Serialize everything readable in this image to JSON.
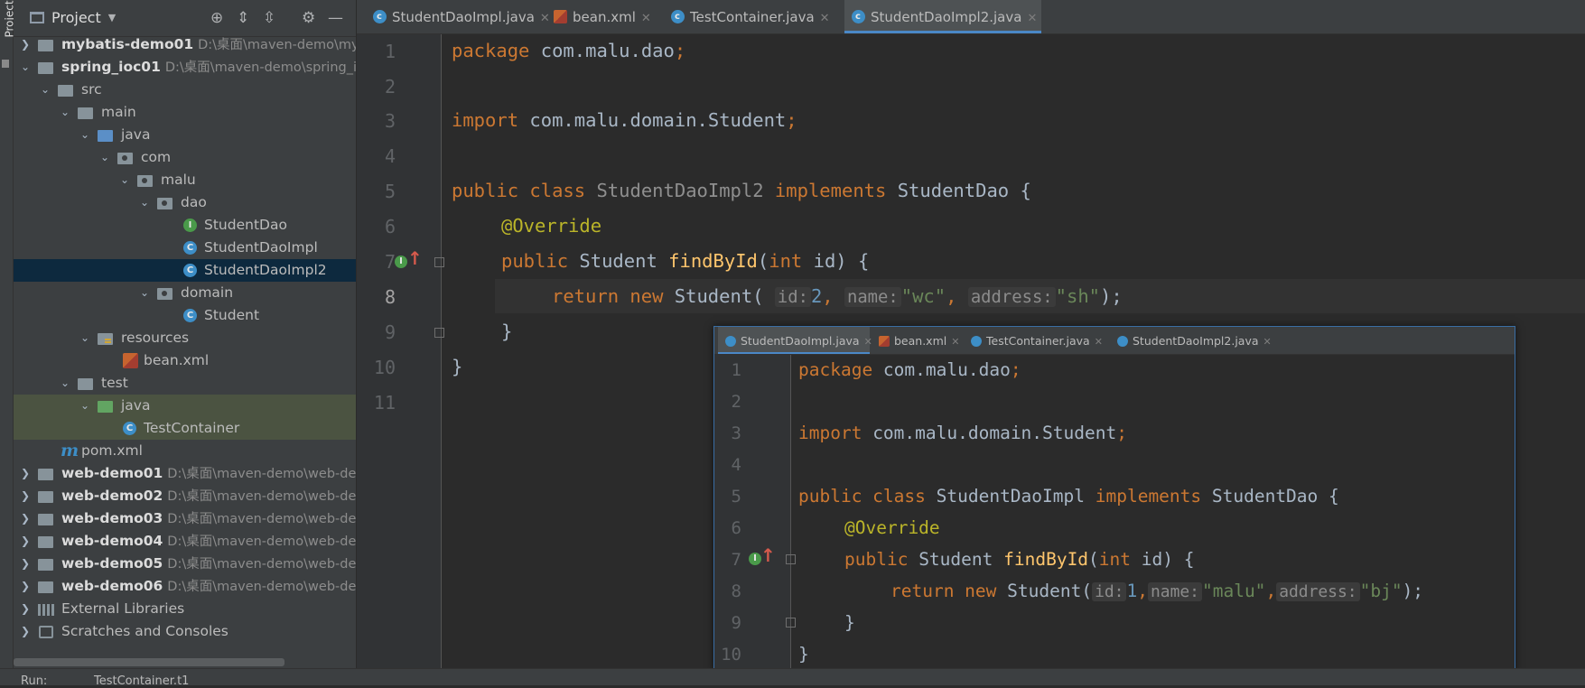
{
  "sidebar_stripe": {
    "label": "Project"
  },
  "project_panel": {
    "title": "Project",
    "tree": [
      {
        "label": "mybatis-demo01",
        "path": "D:\\桌面\\maven-demo\\myb",
        "icon": "module-folder-icon",
        "expanded": false
      },
      {
        "label": "spring_ioc01",
        "path": "D:\\桌面\\maven-demo\\spring_ic",
        "icon": "module-folder-icon",
        "expanded": true
      },
      {
        "label": "src",
        "icon": "folder-icon",
        "expanded": true
      },
      {
        "label": "main",
        "icon": "folder-icon",
        "expanded": true
      },
      {
        "label": "java",
        "icon": "source-folder-icon",
        "expanded": true
      },
      {
        "label": "com",
        "icon": "package-icon",
        "expanded": true
      },
      {
        "label": "malu",
        "icon": "package-icon",
        "expanded": true
      },
      {
        "label": "dao",
        "icon": "package-icon",
        "expanded": true
      },
      {
        "label": "StudentDao",
        "icon": "interface-icon"
      },
      {
        "label": "StudentDaoImpl",
        "icon": "class-icon"
      },
      {
        "label": "StudentDaoImpl2",
        "icon": "class-icon",
        "selected": true
      },
      {
        "label": "domain",
        "icon": "package-icon",
        "expanded": true
      },
      {
        "label": "Student",
        "icon": "class-icon"
      },
      {
        "label": "resources",
        "icon": "resources-folder-icon",
        "expanded": true
      },
      {
        "label": "bean.xml",
        "icon": "xml-file-icon"
      },
      {
        "label": "test",
        "icon": "folder-icon",
        "expanded": true
      },
      {
        "label": "java",
        "icon": "test-folder-icon",
        "expanded": true
      },
      {
        "label": "TestContainer",
        "icon": "test-class-icon"
      },
      {
        "label": "pom.xml",
        "icon": "maven-icon"
      },
      {
        "label": "web-demo01",
        "path": "D:\\桌面\\maven-demo\\web-de",
        "icon": "module-folder-icon",
        "expanded": false
      },
      {
        "label": "web-demo02",
        "path": "D:\\桌面\\maven-demo\\web-de",
        "icon": "module-folder-icon",
        "expanded": false
      },
      {
        "label": "web-demo03",
        "path": "D:\\桌面\\maven-demo\\web-de",
        "icon": "module-folder-icon",
        "expanded": false
      },
      {
        "label": "web-demo04",
        "path": "D:\\桌面\\maven-demo\\web-de",
        "icon": "module-folder-icon",
        "expanded": false
      },
      {
        "label": "web-demo05",
        "path": "D:\\桌面\\maven-demo\\web-de",
        "icon": "module-folder-icon",
        "expanded": false
      },
      {
        "label": "web-demo06",
        "path": "D:\\桌面\\maven-demo\\web-de",
        "icon": "module-folder-icon",
        "expanded": false
      },
      {
        "label": "External Libraries",
        "icon": "libraries-icon",
        "expanded": false
      },
      {
        "label": "Scratches and Consoles",
        "icon": "scratches-icon",
        "expanded": false
      }
    ]
  },
  "editor": {
    "tabs": [
      {
        "label": "StudentDaoImpl.java",
        "icon": "class-icon"
      },
      {
        "label": "bean.xml",
        "icon": "xml-file-icon"
      },
      {
        "label": "TestContainer.java",
        "icon": "test-class-icon"
      },
      {
        "label": "StudentDaoImpl2.java",
        "icon": "class-icon",
        "active": true
      }
    ],
    "line_numbers": [
      "1",
      "2",
      "3",
      "4",
      "5",
      "6",
      "7",
      "8",
      "9",
      "10",
      "11"
    ],
    "current_line": "8",
    "code": {
      "l1_kw": "package",
      "l1_rest": " com.malu.dao",
      "l1_semi": ";",
      "l3_kw": "import",
      "l3_rest": " com.malu.domain.Student",
      "l3_semi": ";",
      "l5_kw1": "public class",
      "l5_name": " StudentDaoImpl2",
      "l5_kw2": " implements",
      "l5_rest": " StudentDao {",
      "l6_ann": "@Override",
      "l7_kw": "public",
      "l7_type": " Student ",
      "l7_fn": "findById",
      "l7_p1": "(",
      "l7_kw2": "int",
      "l7_p2": " id) {",
      "l8_kw": "return new",
      "l8_type": " Student(",
      "l8_h1": "id:",
      "l8_v1": "2",
      "l8_c1": ",",
      "l8_h2": "name:",
      "l8_v2": "\"wc\"",
      "l8_c2": ",",
      "l8_h3": "address:",
      "l8_v3": "\"sh\"",
      "l8_end": ");",
      "l9": "}",
      "l10": "}"
    }
  },
  "preview": {
    "tabs": [
      {
        "label": "StudentDaoImpl.java",
        "icon": "class-icon",
        "active": true
      },
      {
        "label": "bean.xml",
        "icon": "xml-file-icon"
      },
      {
        "label": "TestContainer.java",
        "icon": "test-class-icon"
      },
      {
        "label": "StudentDaoImpl2.java",
        "icon": "class-icon"
      }
    ],
    "line_numbers": [
      "1",
      "2",
      "3",
      "4",
      "5",
      "6",
      "7",
      "8",
      "9",
      "10"
    ],
    "code": {
      "l1_kw": "package",
      "l1_rest": " com.malu.dao",
      "l1_semi": ";",
      "l3_kw": "import",
      "l3_rest": " com.malu.domain.Student",
      "l3_semi": ";",
      "l5_kw1": "public class",
      "l5_name": " StudentDaoImpl",
      "l5_kw2": " implements",
      "l5_rest": " StudentDao {",
      "l6_ann": "@Override",
      "l7_kw": "public",
      "l7_type": " Student ",
      "l7_fn": "findById",
      "l7_p1": "(",
      "l7_kw2": "int",
      "l7_p2": " id) {",
      "l8_kw": "return new",
      "l8_type": " Student(",
      "l8_h1": "id:",
      "l8_v1": "1",
      "l8_c1": ",",
      "l8_h2": "name:",
      "l8_v2": "\"malu\"",
      "l8_c2": ",",
      "l8_h3": "address:",
      "l8_v3": "\"bj\"",
      "l8_end": ");",
      "l9": "}",
      "l10": "}"
    }
  },
  "run_bar": {
    "label": "Run:",
    "config": "TestContainer.t1"
  },
  "colors": {
    "keyword": "#cc7832",
    "annotation": "#bbb529",
    "function": "#ffc66d",
    "string": "#6a8759",
    "number": "#6897bb",
    "selection": "#0d293e",
    "accent": "#4a88c7"
  }
}
